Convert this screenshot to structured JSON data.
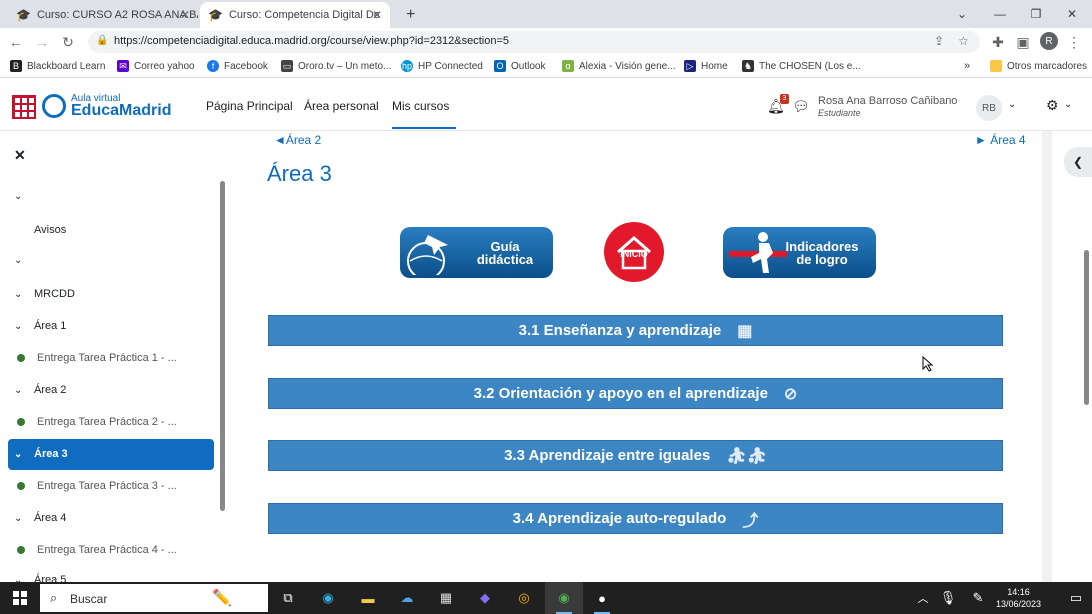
{
  "browser": {
    "tabs": [
      {
        "title": "Curso: CURSO A2 ROSA ANA BA",
        "active": false
      },
      {
        "title": "Curso: Competencia Digital Doce",
        "active": true
      }
    ],
    "url": "https://competenciadigital.educa.madrid.org/course/view.php?id=2312&section=5",
    "profile_initial": "R",
    "bookmarks": [
      "Blackboard Learn",
      "Correo yahoo",
      "Facebook",
      "Ororo.tv – Un meto...",
      "HP Connected",
      "Outlook",
      "Alexia - Visión gene...",
      "Home",
      "The CHOSEN (Los e..."
    ],
    "other_bookmarks": "Otros marcadores"
  },
  "header": {
    "logo_sub": "Aula virtual",
    "logo_main": "EducaMadrid",
    "nav": [
      "Página Principal",
      "Área personal",
      "Mis cursos"
    ],
    "notification_count": "3",
    "user_name": "Rosa Ana Barroso Cañibano",
    "user_role": "Estudiante",
    "user_initials": "RB"
  },
  "drawer": {
    "items": [
      {
        "label": "",
        "type": "chevron"
      },
      {
        "label": "Avisos",
        "type": "plain"
      },
      {
        "label": "",
        "type": "chevron"
      },
      {
        "label": "MRCDD",
        "type": "chevron"
      },
      {
        "label": "Área 1",
        "type": "chevron"
      },
      {
        "label": "Entrega Tarea Práctica 1 - ...",
        "type": "dot"
      },
      {
        "label": "Área 2",
        "type": "chevron"
      },
      {
        "label": "Entrega Tarea Práctica 2 - ...",
        "type": "dot"
      },
      {
        "label": "Área 3",
        "type": "active"
      },
      {
        "label": "Entrega Tarea Práctica 3 - ...",
        "type": "dot"
      },
      {
        "label": "Área 4",
        "type": "chevron"
      },
      {
        "label": "Entrega Tarea Práctica 4 - ...",
        "type": "dot"
      },
      {
        "label": "Área 5",
        "type": "chevron"
      }
    ]
  },
  "main": {
    "prev_link": "◄Área 2",
    "next_link": "► Área 4",
    "section_title": "Área 3",
    "guide_button": "Guía didáctica",
    "home_button": "INICIO",
    "indicators_button": "Indicadores de logro",
    "topics": [
      "3.1 Enseñanza y aprendizaje",
      "3.2 Orientación y apoyo en el aprendizaje",
      "3.3 Aprendizaje entre iguales",
      "3.4 Aprendizaje auto-regulado"
    ]
  },
  "taskbar": {
    "search_placeholder": "Buscar",
    "time": "14:16",
    "date": "13/06/2023"
  }
}
